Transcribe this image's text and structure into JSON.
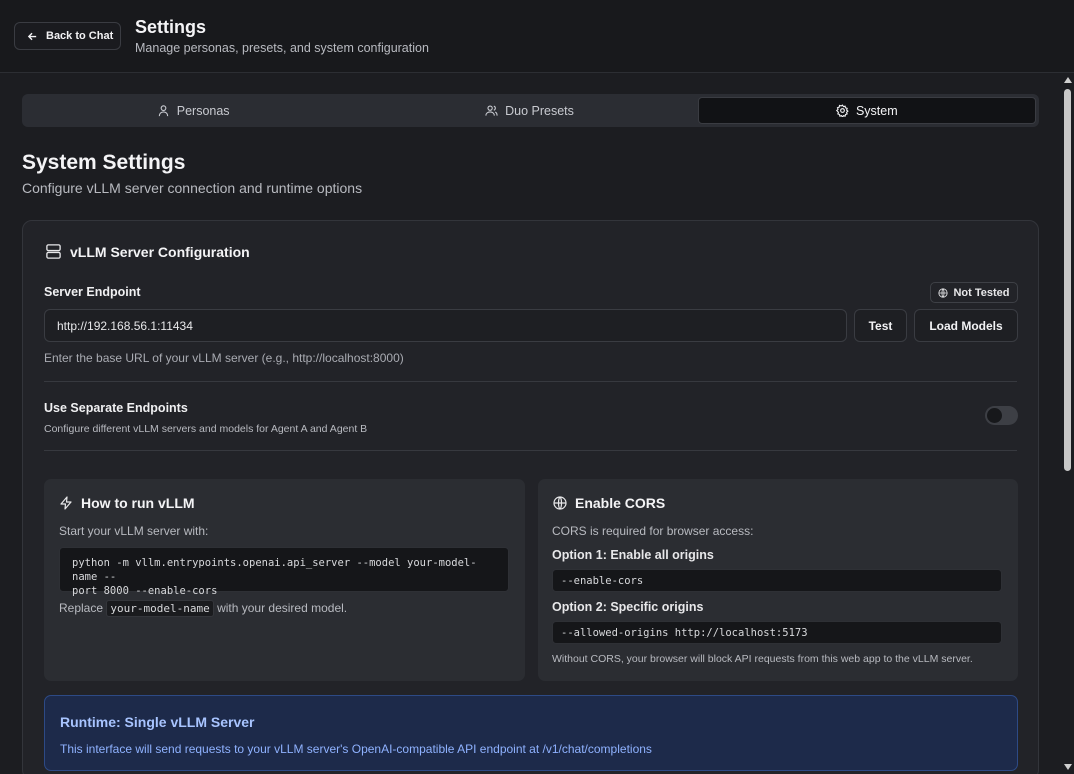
{
  "header": {
    "back_label": "Back to Chat",
    "title": "Settings",
    "subtitle": "Manage personas, presets, and system configuration"
  },
  "tabs": [
    {
      "label": "Personas",
      "icon": "user-icon",
      "active": false
    },
    {
      "label": "Duo Presets",
      "icon": "users-icon",
      "active": false
    },
    {
      "label": "System",
      "icon": "gear-icon",
      "active": true
    }
  ],
  "page": {
    "title": "System Settings",
    "subtitle": "Configure vLLM server connection and runtime options"
  },
  "server_card": {
    "title": "vLLM Server Configuration",
    "icon": "server-icon",
    "endpoint_label": "Server Endpoint",
    "status_badge": "Not Tested",
    "endpoint_value": "http://192.168.56.1:11434",
    "test_label": "Test",
    "load_models_label": "Load Models",
    "endpoint_help": "Enter the base URL of your vLLM server (e.g., http://localhost:8000)",
    "separate_title": "Use Separate Endpoints",
    "separate_desc": "Configure different vLLM servers and models for Agent A and Agent B",
    "separate_enabled": false
  },
  "run_panel": {
    "title": "How to run vLLM",
    "icon": "zap-icon",
    "intro": "Start your vLLM server with:",
    "code_line1": "python -m vllm.entrypoints.openai.api_server --model your-model-name --",
    "code_line2": "port 8000 --enable-cors",
    "replace_prefix": "Replace",
    "replace_code": "your-model-name",
    "replace_suffix": "with your desired model."
  },
  "cors_panel": {
    "title": "Enable CORS",
    "icon": "globe-icon",
    "intro": "CORS is required for browser access:",
    "option1_label": "Option 1: Enable all origins",
    "option1_code": "--enable-cors",
    "option2_label": "Option 2: Specific origins",
    "option2_code": "--allowed-origins http://localhost:5173",
    "note": "Without CORS, your browser will block API requests from this web app to the vLLM server."
  },
  "runtime": {
    "title": "Runtime: Single vLLM Server",
    "text": "This interface will send requests to your vLLM server's OpenAI-compatible API endpoint at /v1/chat/completions"
  },
  "colors": {
    "accent_blue": "#8fb2ff",
    "info_bg": "#1d2a4a",
    "background": "#1c1d21"
  }
}
